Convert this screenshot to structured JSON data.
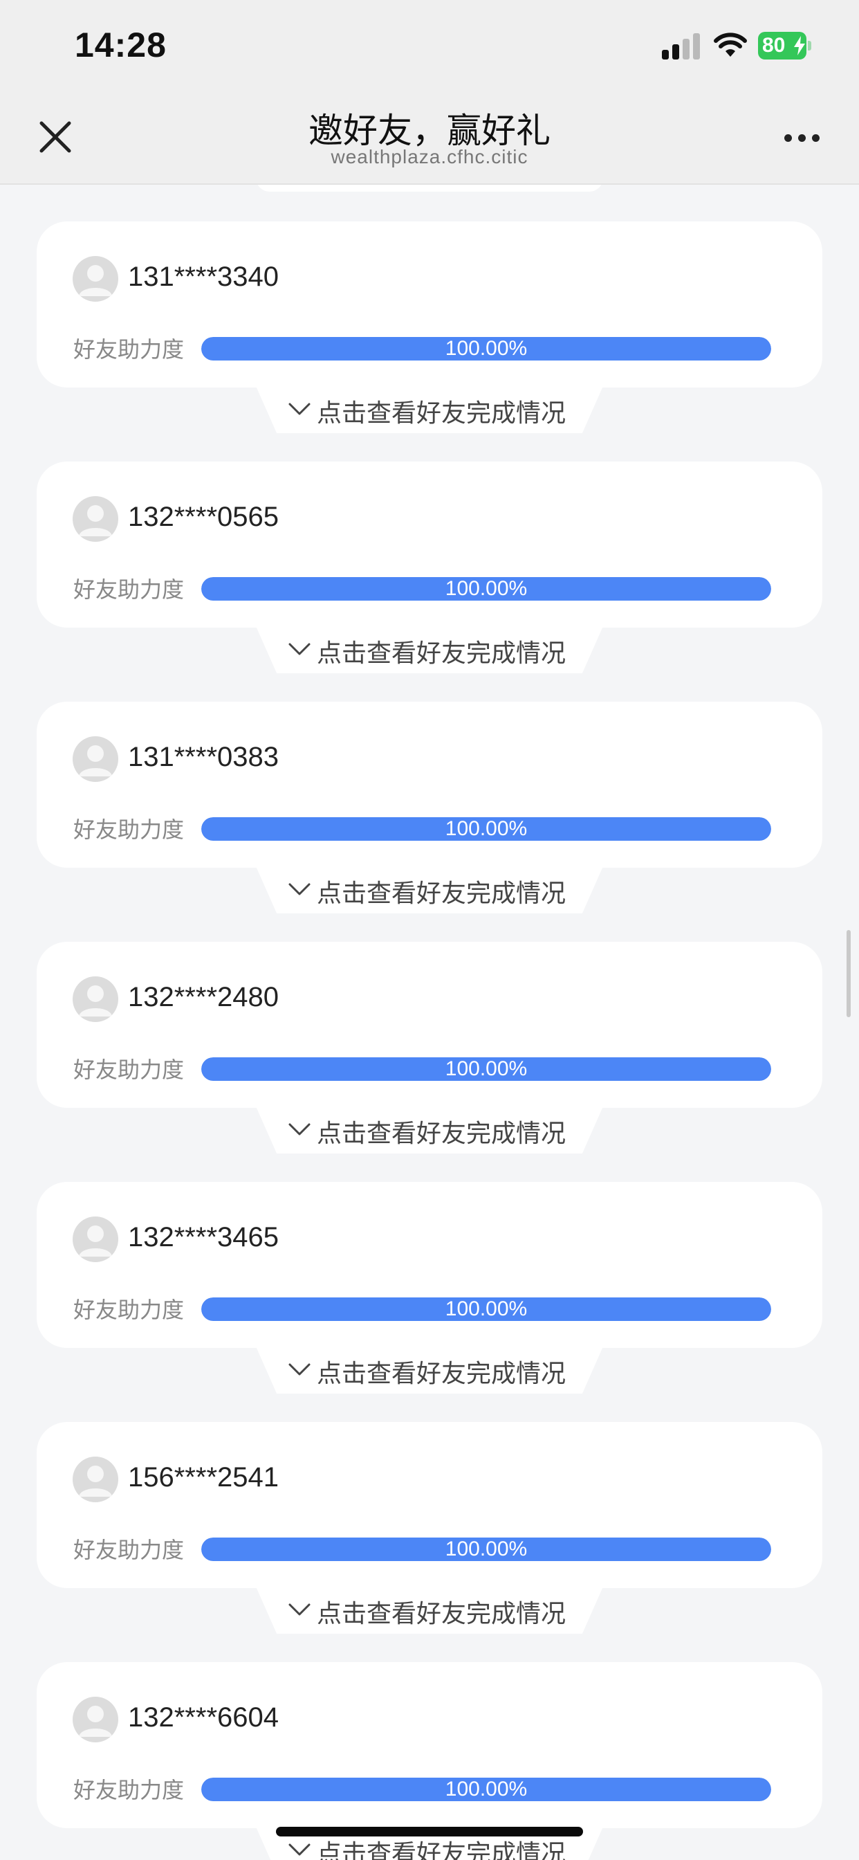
{
  "status_bar": {
    "time": "14:28",
    "battery": "80",
    "icons": [
      "signal-icon",
      "wifi-icon",
      "battery-icon",
      "charging-bolt-icon"
    ]
  },
  "nav": {
    "title": "邀好友，赢好礼",
    "subtitle": "wealthplaza.cfhc.citic",
    "icons": [
      "close-icon",
      "more-icon"
    ]
  },
  "invites": [
    {
      "phone": "131****3340",
      "progress_label": "好友助力度",
      "progress_percent": 100,
      "progress_text": "100.00%",
      "expand_label": "点击查看好友完成情况"
    },
    {
      "phone": "132****0565",
      "progress_label": "好友助力度",
      "progress_percent": 100,
      "progress_text": "100.00%",
      "expand_label": "点击查看好友完成情况"
    },
    {
      "phone": "131****0383",
      "progress_label": "好友助力度",
      "progress_percent": 100,
      "progress_text": "100.00%",
      "expand_label": "点击查看好友完成情况"
    },
    {
      "phone": "132****2480",
      "progress_label": "好友助力度",
      "progress_percent": 100,
      "progress_text": "100.00%",
      "expand_label": "点击查看好友完成情况"
    },
    {
      "phone": "132****3465",
      "progress_label": "好友助力度",
      "progress_percent": 100,
      "progress_text": "100.00%",
      "expand_label": "点击查看好友完成情况"
    },
    {
      "phone": "156****2541",
      "progress_label": "好友助力度",
      "progress_percent": 100,
      "progress_text": "100.00%",
      "expand_label": "点击查看好友完成情况"
    },
    {
      "phone": "132****6604",
      "progress_label": "好友助力度",
      "progress_percent": 100,
      "progress_text": "100.00%",
      "expand_label": "点击查看好友完成情况"
    }
  ],
  "colors": {
    "progress_fill": "#4c86f6",
    "page_background": "#f4f5f7",
    "card_background": "#ffffff",
    "battery_green": "#34c759"
  }
}
